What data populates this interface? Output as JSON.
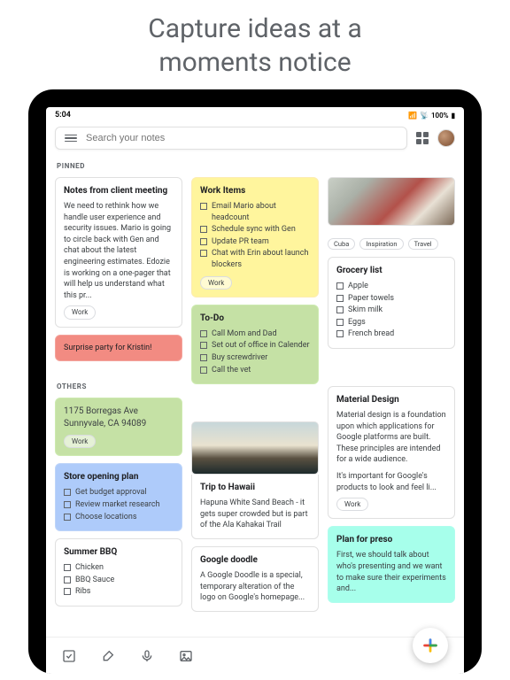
{
  "hero": {
    "line1": "Capture ideas at a",
    "line2": "moments notice"
  },
  "status": {
    "time": "5:04",
    "signal": "••ıl",
    "wifi": "wifi",
    "battery": "100%"
  },
  "search": {
    "placeholder": "Search your notes"
  },
  "sections": {
    "pinned": "PINNED",
    "others": "OTHERS"
  },
  "labels": {
    "work": "Work"
  },
  "notes": {
    "client": {
      "title": "Notes from client meeting",
      "body": "We need to rethink how we handle user experience and security issues. Mario is going to circle back with Gen and chat about the latest engineering estimates. Edozie is working on a one-pager that will help us understand what this pr..."
    },
    "surprise": {
      "body": "Surprise party for Kristin!"
    },
    "workitems": {
      "title": "Work Items",
      "items": [
        "Email Mario about headcount",
        "Schedule sync with Gen",
        "Update PR team",
        "Chat with Erin about launch blockers"
      ]
    },
    "todo": {
      "title": "To-Do",
      "items": [
        "Call Mom and Dad",
        "Set out of office in Calender",
        "Buy screwdriver",
        "Call the vet"
      ]
    },
    "photo_tags": [
      "Cuba",
      "Inspiration",
      "Travel"
    ],
    "grocery": {
      "title": "Grocery list",
      "items": [
        "Apple",
        "Paper towels",
        "Skim milk",
        "Eggs",
        "French bread"
      ]
    },
    "address": {
      "line1": "1175 Borregas Ave",
      "line2": "Sunnyvale, CA 94089"
    },
    "storeplan": {
      "title": "Store opening plan",
      "items": [
        "Get budget approval",
        "Review market research",
        "Choose locations"
      ]
    },
    "bbq": {
      "title": "Summer BBQ",
      "items": [
        "Chicken",
        "BBQ Sauce",
        "Ribs"
      ]
    },
    "hawaii": {
      "title": "Trip to Hawaii",
      "body": "Hapuna White Sand Beach - it gets super crowded but is part of the Ala Kahakai Trail"
    },
    "doodle": {
      "title": "Google doodle",
      "body": "A Google Doodle is a special, temporary alteration of the logo on Google's homepage..."
    },
    "material": {
      "title": "Material Design",
      "body1": "Material design is a foundation upon which applications for Google platforms are built. These principles are intended for a wide audience.",
      "body2": "It's important for Google's products to look and feel li..."
    },
    "preso": {
      "title": "Plan for preso",
      "body": "First, we should talk about who's presenting and we want to make sure their experiments and..."
    }
  },
  "colors": {
    "yellow": "#fff59d",
    "green": "#c5e1a5",
    "red": "#f28b82",
    "blue": "#aecbfa",
    "teal": "#a7ffeb"
  },
  "bottombar": {
    "checkbox": "checkbox-icon",
    "brush": "brush-icon",
    "mic": "mic-icon",
    "image": "image-icon",
    "add": "add-note"
  }
}
